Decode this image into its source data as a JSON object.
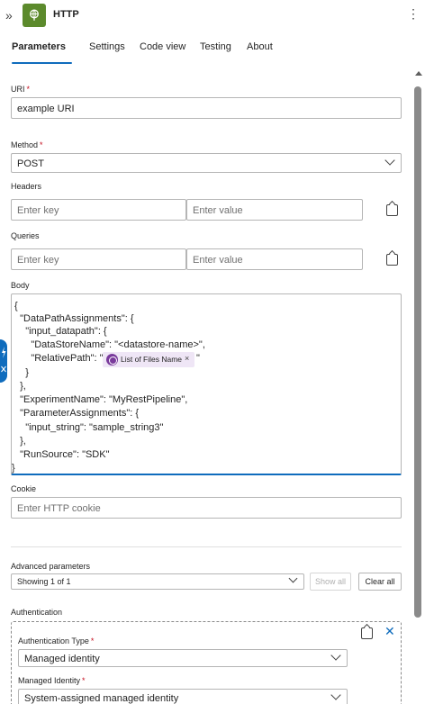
{
  "header": {
    "title": "HTTP",
    "brand_color": "#5c8a2c"
  },
  "tabs": [
    "Parameters",
    "Settings",
    "Code view",
    "Testing",
    "About"
  ],
  "uri": {
    "label": "URI",
    "value": "example URI"
  },
  "method": {
    "label": "Method",
    "value": "POST"
  },
  "headers": {
    "label": "Headers",
    "key_placeholder": "Enter key",
    "value_placeholder": "Enter value"
  },
  "queries": {
    "label": "Queries",
    "key_placeholder": "Enter key",
    "value_placeholder": "Enter value"
  },
  "body": {
    "label": "Body",
    "lines": [
      "{",
      "  \"DataPathAssignments\": {",
      "    \"input_datapath\": {",
      "      \"DataStoreName\": \"<datastore-name>\",",
      "      \"RelativePath\": \"",
      "    }",
      "  },",
      "  \"ExperimentName\": \"MyRestPipeline\",",
      "  \"ParameterAssignments\": {",
      "    \"input_string\": \"sample_string3\"",
      "  },",
      "  \"RunSource\": \"SDK\"",
      "}"
    ],
    "token": {
      "label": "List of Files Name",
      "close": "×",
      "after": "\""
    }
  },
  "cookie": {
    "label": "Cookie",
    "placeholder": "Enter HTTP cookie"
  },
  "advanced": {
    "label": "Advanced parameters",
    "value": "Showing 1 of 1",
    "show_all": "Show all",
    "clear_all": "Clear all"
  },
  "authentication": {
    "label": "Authentication",
    "type_label": "Authentication Type",
    "type_value": "Managed identity",
    "identity_label": "Managed Identity",
    "identity_value": "System-assigned managed identity"
  }
}
